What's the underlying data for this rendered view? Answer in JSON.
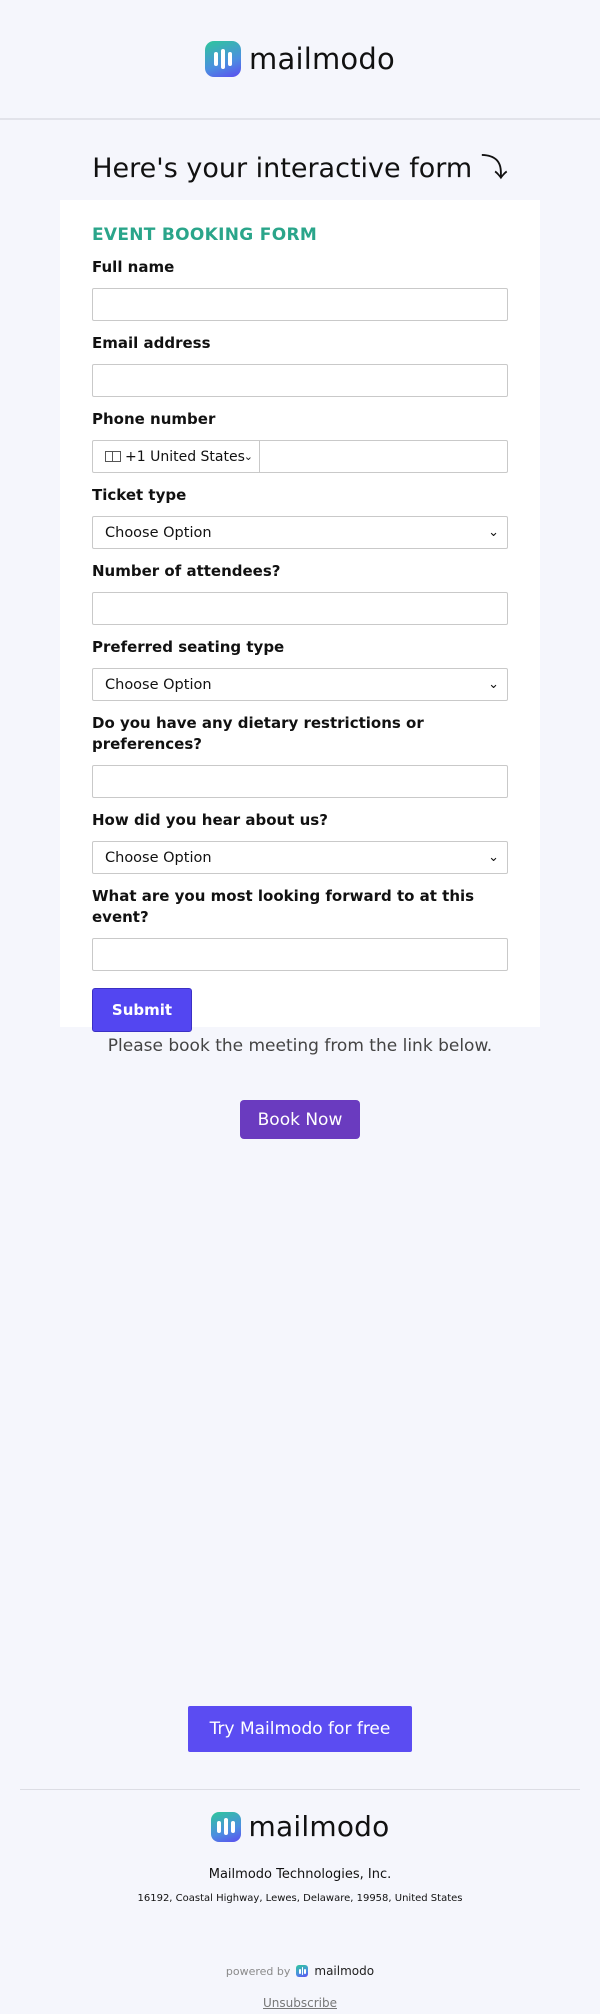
{
  "brand": {
    "name": "mailmodo",
    "accent": "#5346f1",
    "logo_gradient": [
      "#2ec79b",
      "#5c4cf0"
    ]
  },
  "headline": "Here's your interactive form ⤵",
  "form": {
    "title": "EVENT BOOKING FORM",
    "title_color": "#2aa58a",
    "fields": {
      "full_name": {
        "label": "Full name",
        "value": ""
      },
      "email": {
        "label": "Email address",
        "value": ""
      },
      "phone": {
        "label": "Phone number",
        "country_code": "+1 United States",
        "value": ""
      },
      "ticket_type": {
        "label": "Ticket type",
        "selected": "Choose Option"
      },
      "attendees": {
        "label": "Number of attendees?",
        "value": ""
      },
      "seating": {
        "label": "Preferred seating type",
        "selected": "Choose Option"
      },
      "dietary": {
        "label": "Do you have any dietary restrictions or preferences?",
        "value": ""
      },
      "referral": {
        "label": "How did you hear about us?",
        "selected": "Choose Option"
      },
      "looking_forward": {
        "label": "What are you most looking forward to at this event?",
        "value": ""
      }
    },
    "submit_label": "Submit"
  },
  "booking": {
    "note": "Please book the meeting from the link below.",
    "button": "Book Now",
    "button_color": "#6a3bbf"
  },
  "cta": {
    "label": "Try Mailmodo for free"
  },
  "footer": {
    "company": "Mailmodo Technologies, Inc.",
    "address": "16192, Coastal Highway, Lewes, Delaware, 19958, United States",
    "powered_by": "powered by",
    "unsubscribe": "Unsubscribe"
  }
}
